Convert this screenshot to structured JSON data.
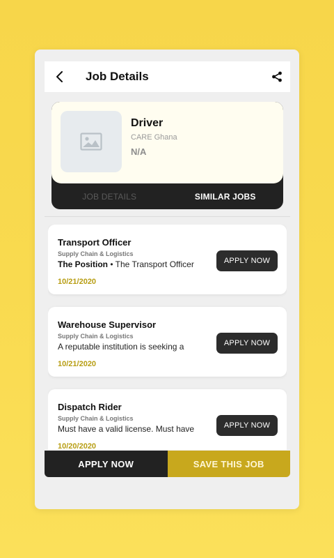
{
  "header": {
    "title": "Job Details"
  },
  "job": {
    "title": "Driver",
    "company": "CARE Ghana",
    "salary": "N/A"
  },
  "tabs": [
    {
      "label": "JOB DETAILS",
      "active": false
    },
    {
      "label": "SIMILAR JOBS",
      "active": true
    }
  ],
  "similar_jobs": [
    {
      "title": "Transport Officer",
      "category": "Supply Chain & Logistics",
      "desc_bold": "The Position",
      "desc_rest": " • The Transport Officer",
      "date": "10/21/2020",
      "apply_label": "APPLY NOW"
    },
    {
      "title": "Warehouse Supervisor",
      "category": "Supply Chain & Logistics",
      "desc_bold": "",
      "desc_rest": "A reputable institution is seeking a",
      "date": "10/21/2020",
      "apply_label": "APPLY NOW"
    },
    {
      "title": "Dispatch Rider",
      "category": "Supply Chain & Logistics",
      "desc_bold": "",
      "desc_rest": "Must have a valid license.  Must have",
      "date": "10/20/2020",
      "apply_label": "APPLY NOW"
    }
  ],
  "bottom": {
    "apply_label": "APPLY NOW",
    "save_label": "SAVE THIS JOB"
  },
  "colors": {
    "background": "#f9da4f",
    "accent_gold": "#c8a81d",
    "date_gold": "#b79d12",
    "dark": "#222222"
  },
  "icons": {
    "back": "arrow-left-icon",
    "share": "share-icon",
    "thumbnail": "image-placeholder-icon"
  }
}
